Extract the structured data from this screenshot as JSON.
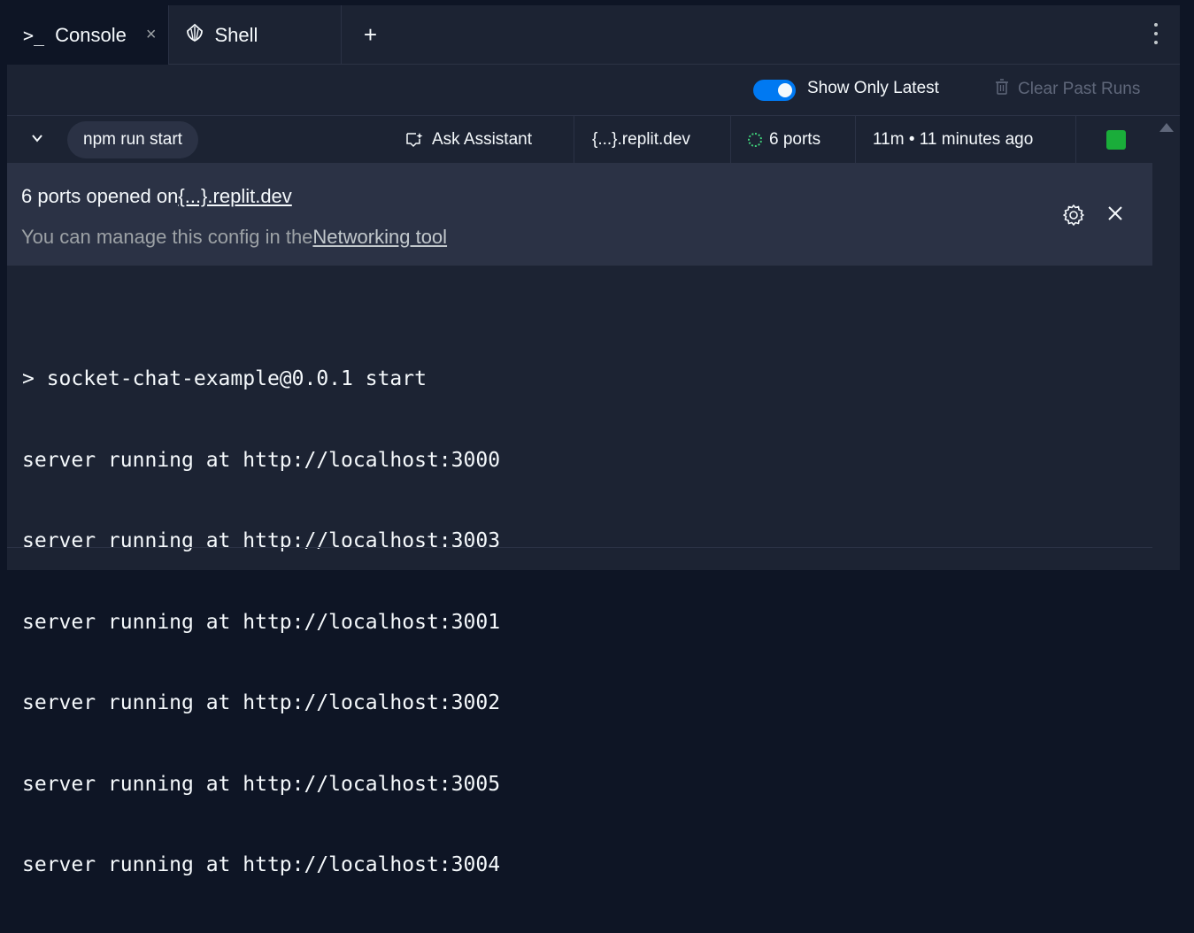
{
  "tabs": [
    {
      "label": "Console",
      "glyph": ">_",
      "close": "×"
    },
    {
      "label": "Shell",
      "icon": "shell-icon"
    }
  ],
  "tab_add": "+",
  "options": {
    "toggle_label": "Show Only Latest",
    "toggle_on": true,
    "clear_label": "Clear Past Runs"
  },
  "runbar": {
    "command": "npm run start",
    "ask_label": "Ask Assistant",
    "domain": "{...}.replit.dev",
    "ports": "6 ports",
    "time": "11m • 11 minutes ago"
  },
  "notice": {
    "line1_prefix": "6 ports opened on",
    "line1_link": "{...}.replit.dev",
    "line2_prefix": "You can manage this config in the",
    "line2_link": "Networking tool"
  },
  "output": [
    "> socket-chat-example@0.0.1 start",
    "server running at http://localhost:3000",
    "server running at http://localhost:3003",
    "server running at http://localhost:3001",
    "server running at http://localhost:3002",
    "server running at http://localhost:3005",
    "server running at http://localhost:3004"
  ],
  "colors": {
    "background": "#1c2333",
    "notice_bg": "#2b3245",
    "accent": "#0079f2",
    "running": "#1aad3a",
    "ports_ring": "#3fd07a"
  }
}
